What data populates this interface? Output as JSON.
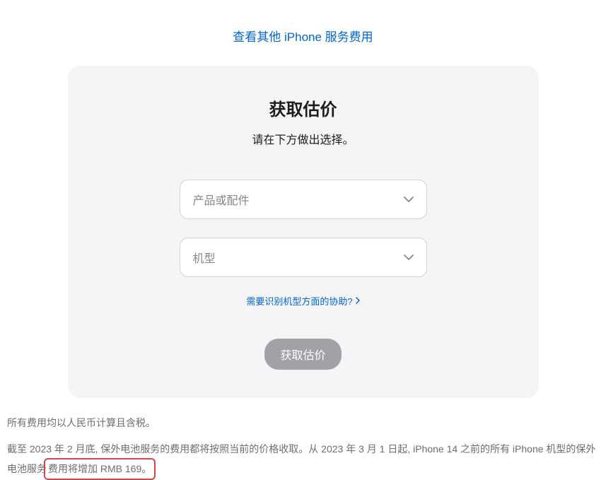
{
  "topLink": {
    "text": "查看其他 iPhone 服务费用"
  },
  "card": {
    "title": "获取估价",
    "subtitle": "请在下方做出选择。",
    "select1_placeholder": "产品或配件",
    "select2_placeholder": "机型",
    "help_link": "需要识别机型方面的协助?",
    "submit_label": "获取估价"
  },
  "disclaimer": {
    "line1": "所有费用均以人民币计算且含税。",
    "line2_part1": "截至 2023 年 2 月底, 保外电池服务的费用都将按照当前的价格收取。从 2023 年 3 月 1 日起, iPhone 14 之前的所有 iPhone 机型的保外电池服务",
    "line2_highlight": "费用将增加 RMB 169。"
  }
}
